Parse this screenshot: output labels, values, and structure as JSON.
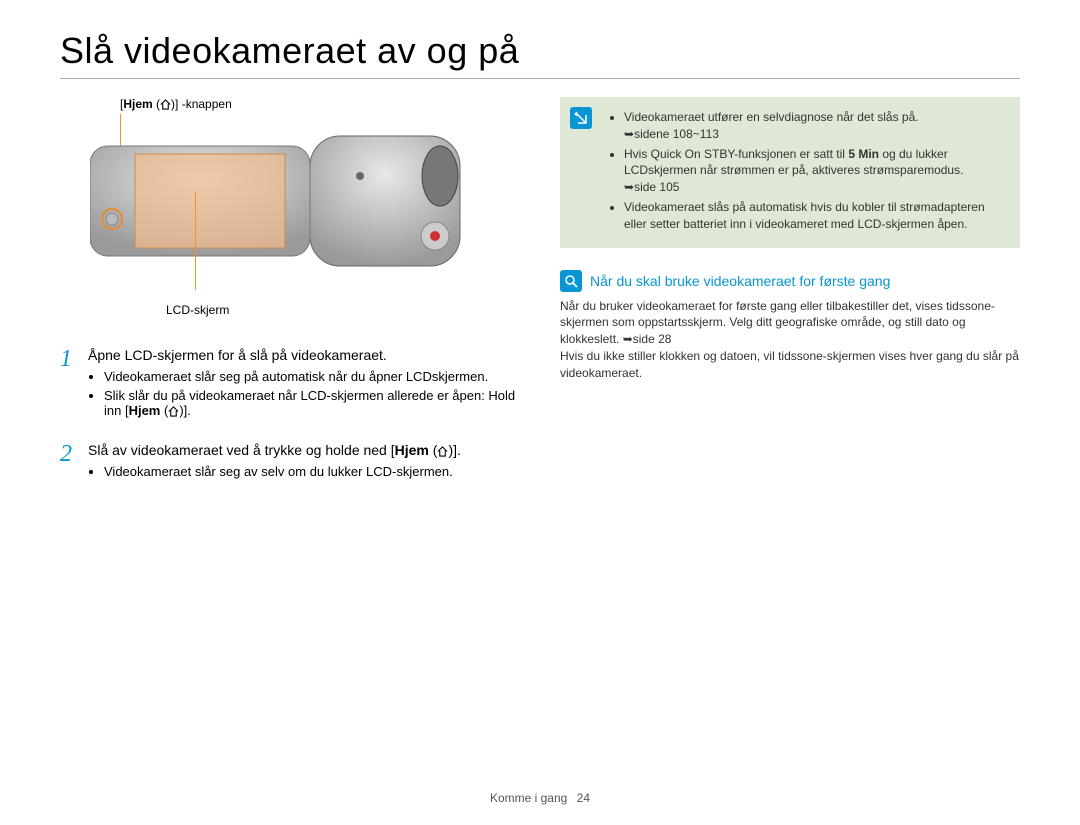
{
  "title": "Slå videokameraet av og på",
  "figure": {
    "home_label_prefix": "[",
    "home_label_bold": "Hjem",
    "home_label_suffix": "] -knappen",
    "lcd_label": "LCD-skjerm"
  },
  "steps": [
    {
      "num": "1",
      "text": "Åpne LCD-skjermen for å slå på videokameraet.",
      "bullets": [
        {
          "text": "Videokameraet slår seg på automatisk når du åpner LCDskjermen."
        },
        {
          "prefix": "Slik slår du på videokameraet når LCD-skjermen allerede er åpen: Hold inn [",
          "bold": "Hjem",
          "suffix": " ( )].",
          "has_icon": true
        }
      ]
    },
    {
      "num": "2",
      "text_prefix": "Slå av videokameraet ved å trykke og holde ned [",
      "text_bold": "Hjem",
      "text_suffix": " ( )].",
      "has_icon": true,
      "bullets": [
        {
          "text": "Videokameraet slår seg av selv om du lukker LCD-skjermen."
        }
      ]
    }
  ],
  "info_box": {
    "bullets": [
      {
        "prefix": "Videokameraet utfører en selvdiagnose når det slås på. ",
        "arrow": "➥",
        "ref": "sidene 108~113"
      },
      {
        "prefix": "Hvis Quick On STBY-funksjonen er satt til ",
        "bold": "5 Min",
        "mid": " og du lukker LCDskjermen når strømmen er på, aktiveres strømsparemodus. ",
        "arrow": "➥",
        "ref": "side 105"
      },
      {
        "text": "Videokameraet slås på automatisk hvis du kobler til strømadapteren eller setter batteriet inn i videokameret med LCD-skjermen åpen."
      }
    ]
  },
  "first_time": {
    "heading": "Når du skal bruke videokameraet for første gang",
    "body_prefix": "Når du bruker videokameraet for første gang eller tilbakestiller det, vises tidssone-skjermen som oppstartsskjerm. Velg ditt geografiske område, og still dato og klokkeslett. ",
    "arrow": "➥",
    "ref": "side 28",
    "body_suffix": "Hvis du ikke stiller klokken og datoen, vil tidssone-skjermen vises hver gang du slår på videokameraet."
  },
  "footer": {
    "section": "Komme i gang",
    "page": "24"
  }
}
